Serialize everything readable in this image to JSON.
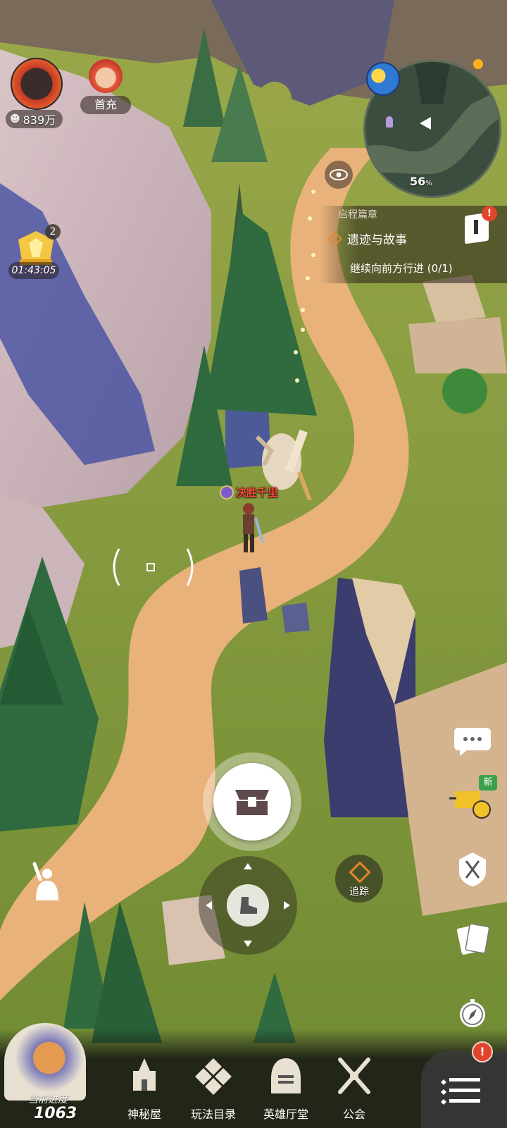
{
  "hud": {
    "resource_value": "839万",
    "first_recharge_label": "首充",
    "event_count": "2",
    "event_timer": "01:43:05"
  },
  "minimap": {
    "percent": "56",
    "percent_unit": "%"
  },
  "quest": {
    "chapter": "启程篇章",
    "title": "遗迹与故事",
    "objective": "继续向前方行进 (0/1)"
  },
  "player": {
    "name": "决胜千里"
  },
  "controls": {
    "track_label": "追踪",
    "new_badge": "新"
  },
  "progress": {
    "label": "当前进度",
    "value": "1063"
  },
  "bottom_nav": [
    {
      "label": "神秘屋"
    },
    {
      "label": "玩法目录"
    },
    {
      "label": "英雄厅堂"
    },
    {
      "label": "公会"
    }
  ],
  "colors": {
    "path": "#e8b27a",
    "grass": "#8ea43f",
    "accent_orange": "#e8862a",
    "alert_red": "#e0452b"
  }
}
